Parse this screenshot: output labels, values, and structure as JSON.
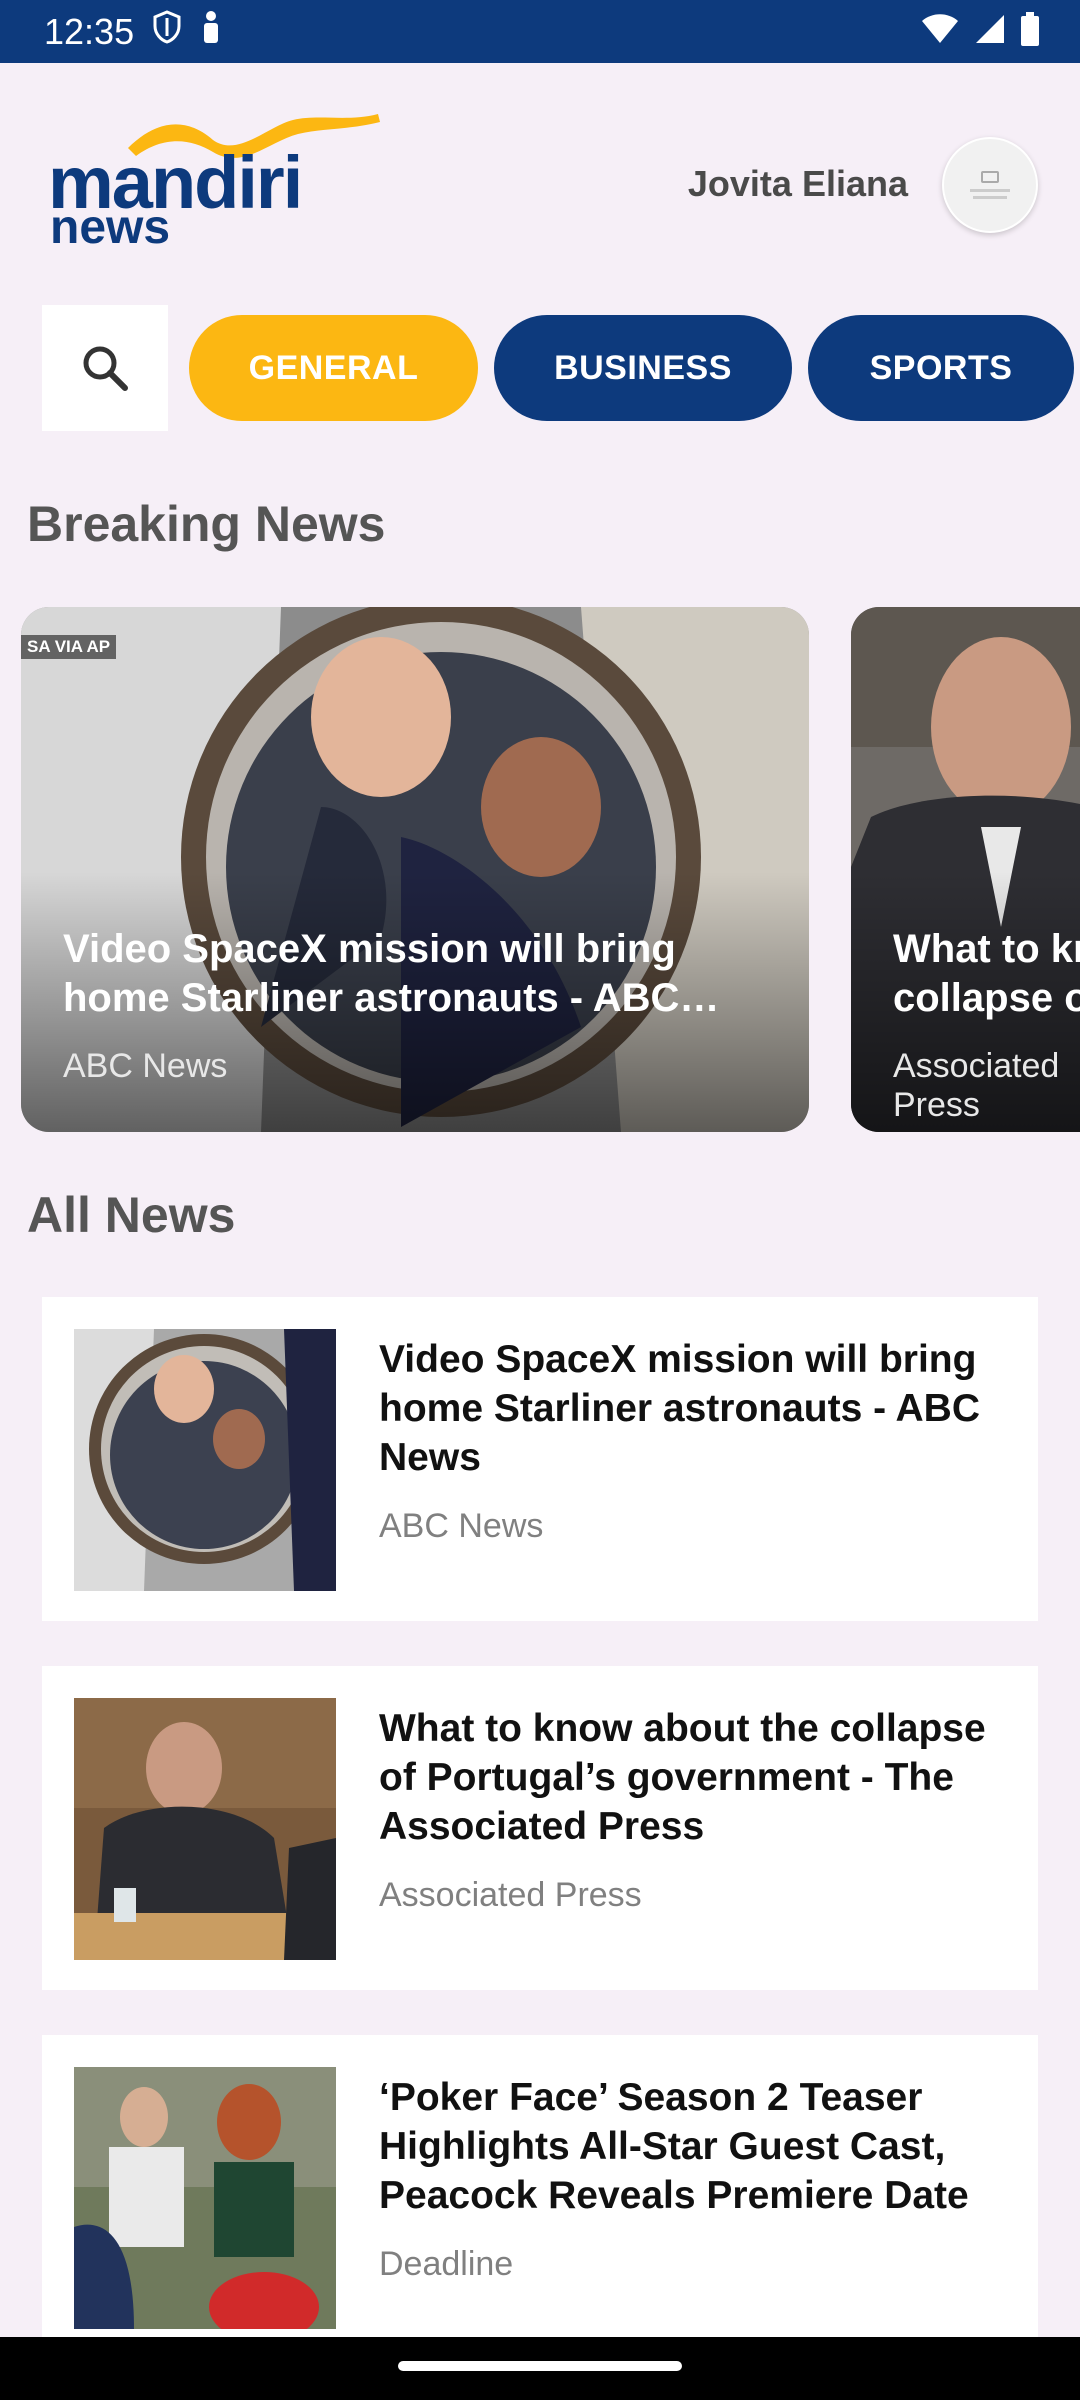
{
  "status_bar": {
    "time": "12:35",
    "icons": [
      "shield-icon",
      "notification-icon",
      "wifi-icon",
      "signal-icon",
      "battery-icon"
    ]
  },
  "header": {
    "logo_line1": "mandiri",
    "logo_line2": "news",
    "user_name": "Jovita Eliana",
    "colors": {
      "brand_blue": "#0d3a7d",
      "brand_yellow": "#fcb712"
    }
  },
  "categories": {
    "search_icon": "search-icon",
    "items": [
      {
        "label": "GENERAL",
        "active": true
      },
      {
        "label": "BUSINESS",
        "active": false
      },
      {
        "label": "SPORTS",
        "active": false
      }
    ]
  },
  "breaking": {
    "title": "Breaking News",
    "cards": [
      {
        "title": "Video SpaceX mission will bring home Starliner astronauts - ABC News",
        "source": "ABC News",
        "credit": "SA VIA AP"
      },
      {
        "title": "What to know about the collapse of Portugal’s government",
        "source": "Associated Press"
      }
    ]
  },
  "all_news": {
    "title": "All News",
    "items": [
      {
        "title": "Video SpaceX mission will bring home Starliner astronauts - ABC News",
        "source": "ABC News"
      },
      {
        "title": "What to know about the collapse of Portugal’s government - The Associated Press",
        "source": "Associated Press"
      },
      {
        "title": "‘Poker Face’ Season 2 Teaser Highlights All-Star Guest Cast, Peacock Reveals Premiere Date",
        "source": "Deadline"
      }
    ]
  }
}
